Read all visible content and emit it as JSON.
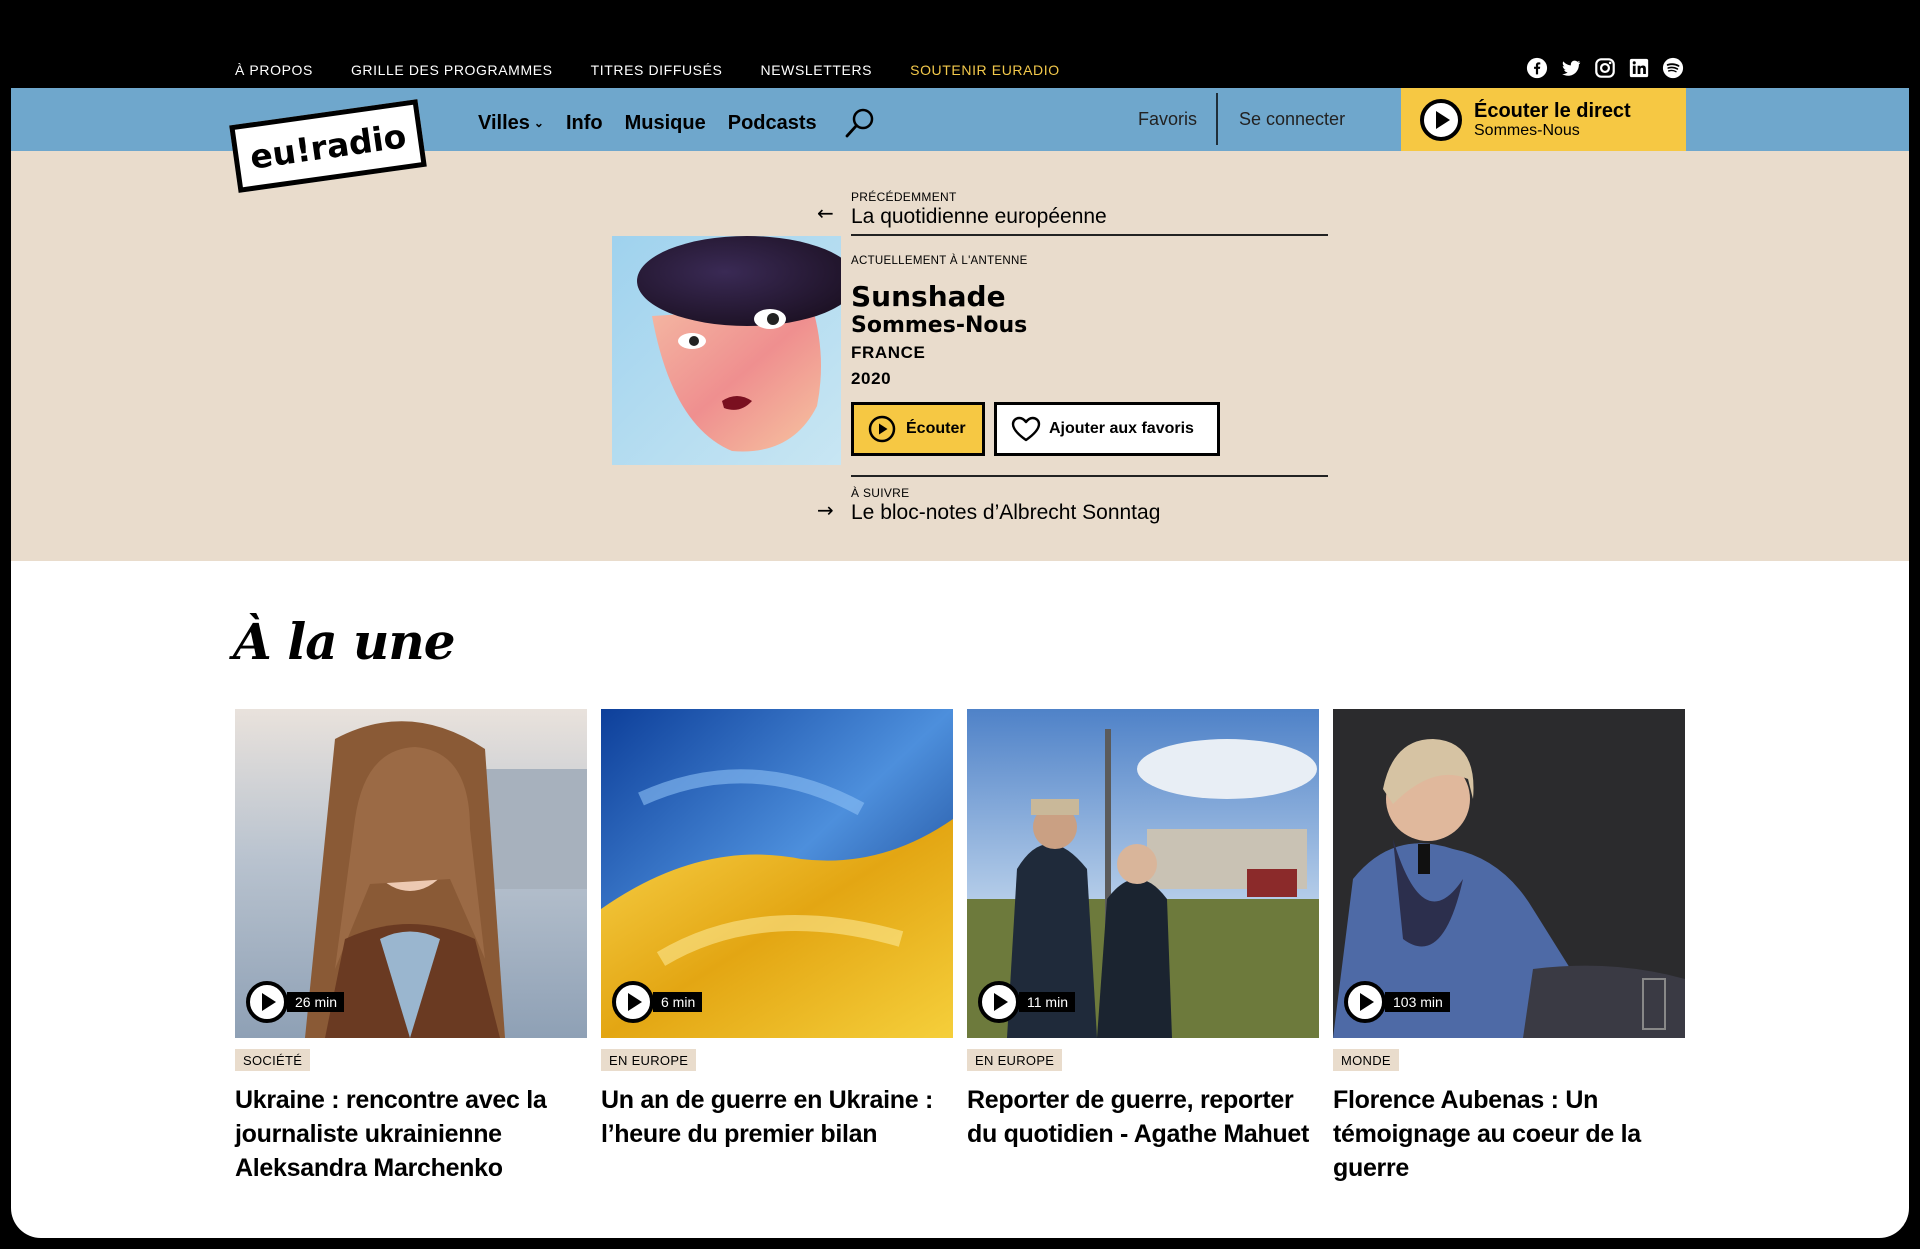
{
  "topnav": {
    "items": [
      "À PROPOS",
      "GRILLE DES PROGRAMMES",
      "TITRES DIFFUSÉS",
      "NEWSLETTERS"
    ],
    "support": "SOUTENIR EURADIO"
  },
  "socials": [
    "facebook-icon",
    "twitter-icon",
    "instagram-icon",
    "linkedin-icon",
    "spotify-icon"
  ],
  "brand": {
    "logo": "eu!radio"
  },
  "mainnav": {
    "villes": "Villes",
    "info": "Info",
    "musique": "Musique",
    "podcasts": "Podcasts"
  },
  "header": {
    "favoris": "Favoris",
    "login": "Se connecter",
    "live_title": "Écouter le direct",
    "live_sub": "Sommes-Nous"
  },
  "player": {
    "prev_label": "PRÉCÉDEMMENT",
    "prev_title": "La quotidienne européenne",
    "now_label": "ACTUELLEMENT À L'ANTENNE",
    "track_title": "Sunshade",
    "track_artist": "Sommes-Nous",
    "country": "FRANCE",
    "year": "2020",
    "listen_label": "Écouter",
    "fav_label": "Ajouter aux favoris",
    "next_label": "À SUIVRE",
    "next_title": "Le bloc-notes d’Albrecht Sonntag"
  },
  "headlines": {
    "title": "À la une",
    "cards": [
      {
        "duration": "26 min",
        "tag": "SOCIÉTÉ",
        "title": "Ukraine : rencontre avec la journaliste ukrainienne Aleksandra Marchenko"
      },
      {
        "duration": "6 min",
        "tag": "EN EUROPE",
        "title": "Un an de guerre en Ukraine : l’heure du premier bilan"
      },
      {
        "duration": "11 min",
        "tag": "EN EUROPE",
        "title": "Reporter de guerre, reporter du quotidien - Agathe Mahuet"
      },
      {
        "duration": "103 min",
        "tag": "MONDE",
        "title": "Florence Aubenas : Un témoignage au coeur de la guerre"
      }
    ]
  },
  "colors": {
    "accent": "#f6c843",
    "navbar": "#6fa7cc",
    "hero": "#e9dccc"
  }
}
